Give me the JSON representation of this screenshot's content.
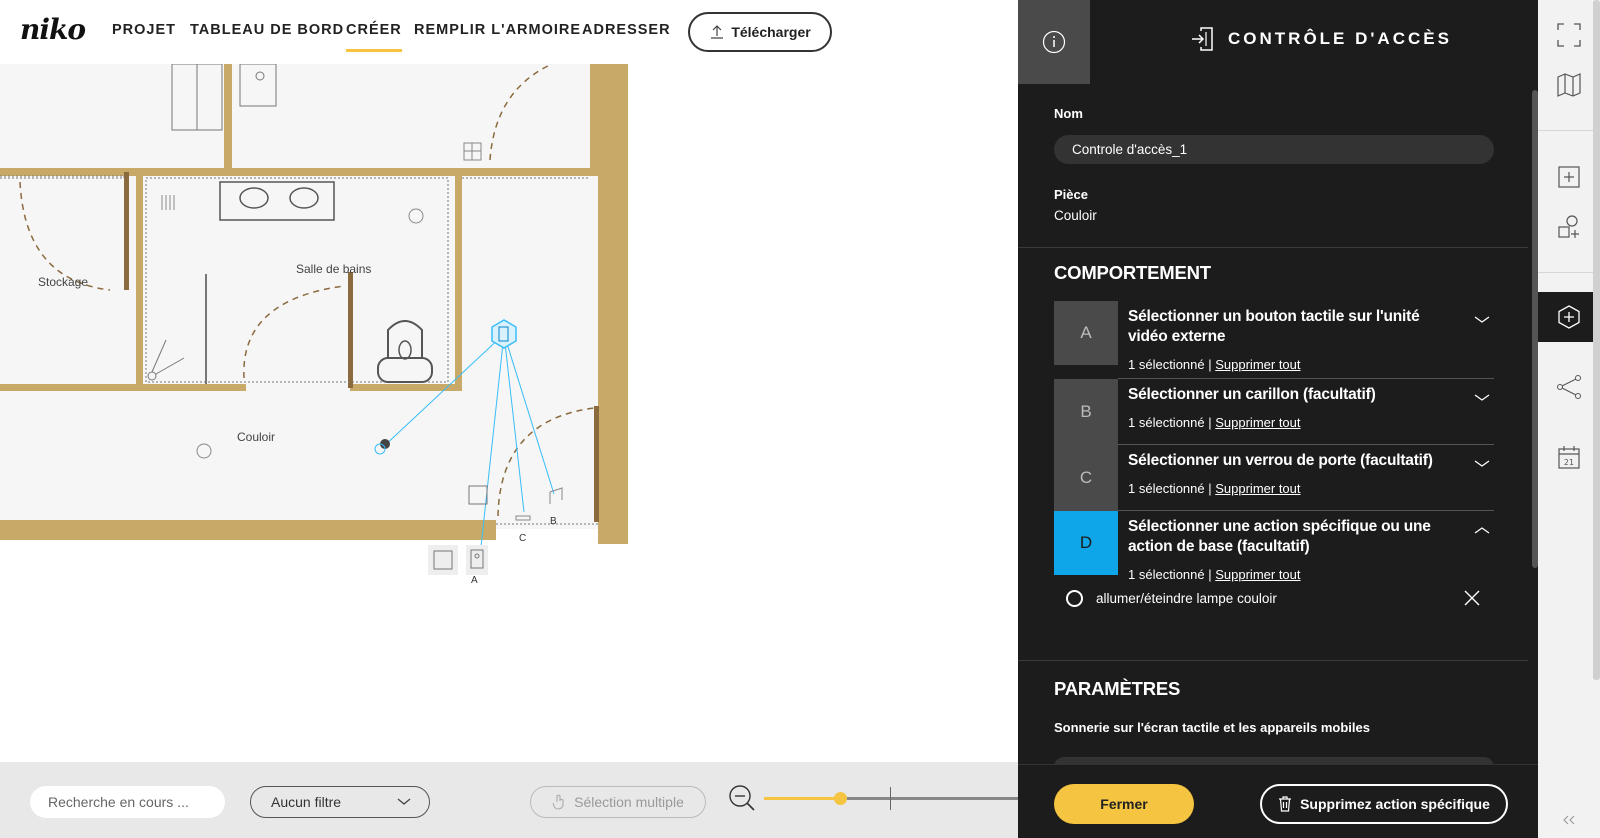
{
  "app": {
    "logo": "niko"
  },
  "nav": {
    "items": [
      {
        "label": "PROJET",
        "active": false
      },
      {
        "label": "TABLEAU DE BORD",
        "active": false
      },
      {
        "label": "CRÉER",
        "active": true
      },
      {
        "label": "REMPLIR L'ARMOIRE",
        "active": false
      },
      {
        "label": "ADRESSER",
        "active": false
      }
    ],
    "upload_label": "Télécharger"
  },
  "floorplan": {
    "rooms": [
      "Stockage",
      "Salle de bains",
      "Couloir"
    ],
    "device_letters": [
      "A",
      "B",
      "C"
    ]
  },
  "toolbar": {
    "search_placeholder": "Recherche en cours ...",
    "filter_label": "Aucun filtre",
    "multi_select_label": "Sélection multiple",
    "zoom_level": 0.3,
    "accent_color": "#f5c542"
  },
  "panel": {
    "title": "CONTRÔLE D'ACCÈS",
    "name_label": "Nom",
    "name_value": "Controle d'accès_1",
    "room_label": "Pièce",
    "room_value": "Couloir",
    "behavior_title": "COMPORTEMENT",
    "behaviors": [
      {
        "letter": "A",
        "title": "Sélectionner un bouton tactile sur l'unité vidéo externe",
        "count": "1 sélectionné |",
        "remove": "Supprimer tout",
        "expanded": false
      },
      {
        "letter": "B",
        "title": "Sélectionner un carillon (facultatif)",
        "count": "1 sélectionné |",
        "remove": "Supprimer tout",
        "expanded": false
      },
      {
        "letter": "C",
        "title": "Sélectionner un verrou de porte (facultatif)",
        "count": "1 sélectionné |",
        "remove": "Supprimer tout",
        "expanded": false
      },
      {
        "letter": "D",
        "title": "Sélectionner une action spécifique ou une action de base (facultatif)",
        "count": "1 sélectionné |",
        "remove": "Supprimer tout",
        "expanded": true
      }
    ],
    "action_item": "allumer/éteindre lampe couloir",
    "params_title": "PARAMÈTRES",
    "params_sub": "Sonnerie sur l'écran tactile et les appareils mobiles",
    "close_label": "Fermer",
    "delete_label": "Supprimez action spécifique",
    "highlight_color": "#0ea5e9"
  },
  "side_tools": [
    "fullscreen-icon",
    "map-icon",
    "add-plan-icon",
    "add-shape-icon",
    "add-device-icon",
    "connect-icon",
    "calendar-icon"
  ]
}
